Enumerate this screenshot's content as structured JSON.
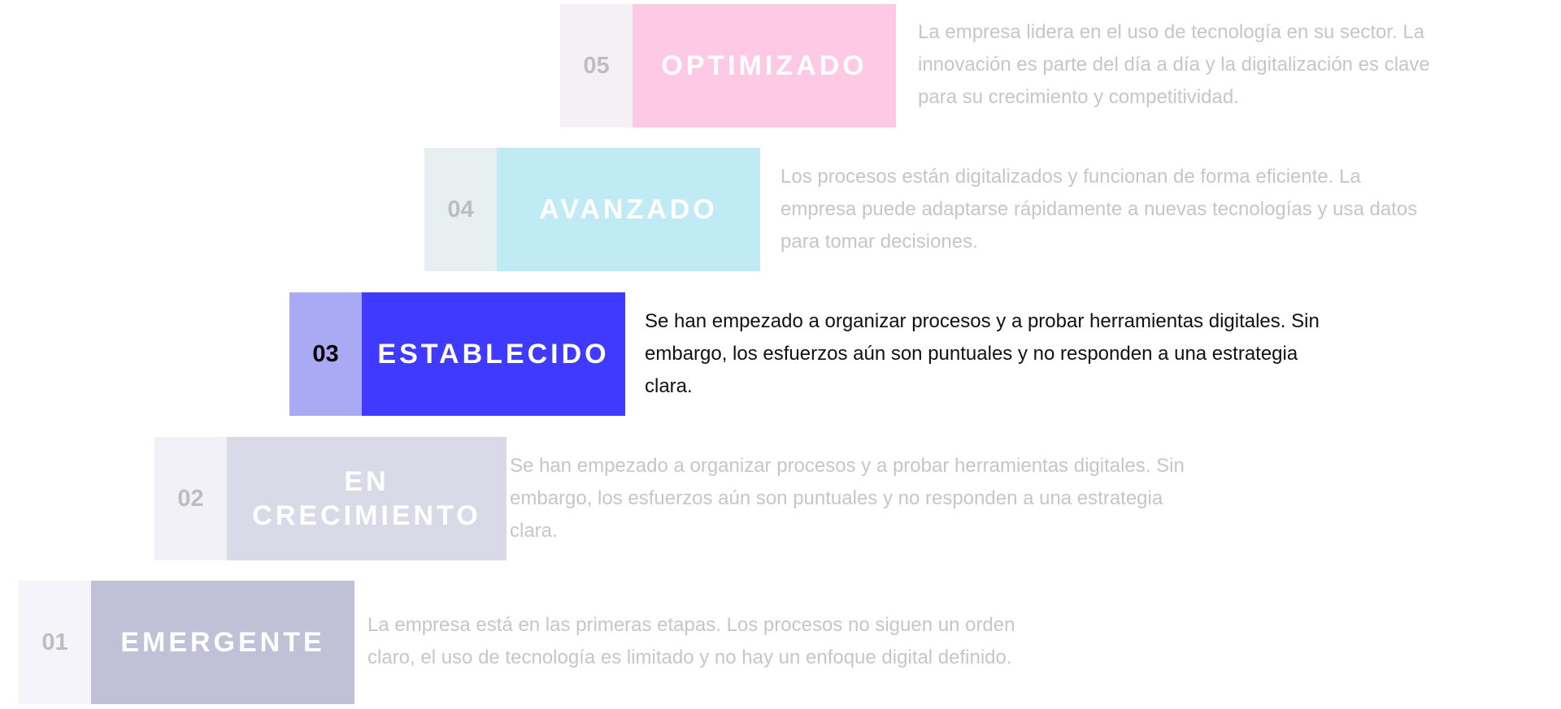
{
  "levels": [
    {
      "number": "05",
      "title": "OPTIMIZADO",
      "lines": [
        "La empresa lidera en el uso de tecnología en su sector. La",
        "innovación es parte del día a día y la digitalización es clave",
        "para su crecimiento y competitividad."
      ],
      "num_bg": "#f5f0f5",
      "label_bg": "#fdc9e4"
    },
    {
      "number": "04",
      "title": "AVANZADO",
      "lines": [
        "Los procesos están digitalizados y funcionan de forma eficiente. La",
        "empresa puede adaptarse rápidamente a nuevas tecnologías y usa datos",
        "para tomar decisiones."
      ],
      "num_bg": "#e7eff1",
      "label_bg": "#c0ebf4"
    },
    {
      "number": "03",
      "title": "ESTABLECIDO",
      "lines": [
        "Se han empezado a organizar procesos y a probar herramientas digitales. Sin",
        "embargo, los esfuerzos aún son puntuales y no responden a una estrategia",
        "clara."
      ],
      "num_bg": "#aaa9f3",
      "label_bg": "#3f3afd",
      "active": true
    },
    {
      "number": "02",
      "title": "EN CRECIMIENTO",
      "lines": [
        "Se han empezado a organizar procesos y a probar herramientas digitales. Sin",
        "embargo, los esfuerzos aún son puntuales y no responden a una estrategia",
        "clara."
      ],
      "num_bg": "#f2f1f7",
      "label_bg": "#dad9e8"
    },
    {
      "number": "01",
      "title": "EMERGENTE",
      "lines": [
        "La empresa está en las primeras etapas. Los procesos no siguen un orden",
        "claro, el uso de tecnología es limitado y no hay un enfoque digital definido."
      ],
      "num_bg": "#f5f4fa",
      "label_bg": "#c0c0d6"
    }
  ]
}
